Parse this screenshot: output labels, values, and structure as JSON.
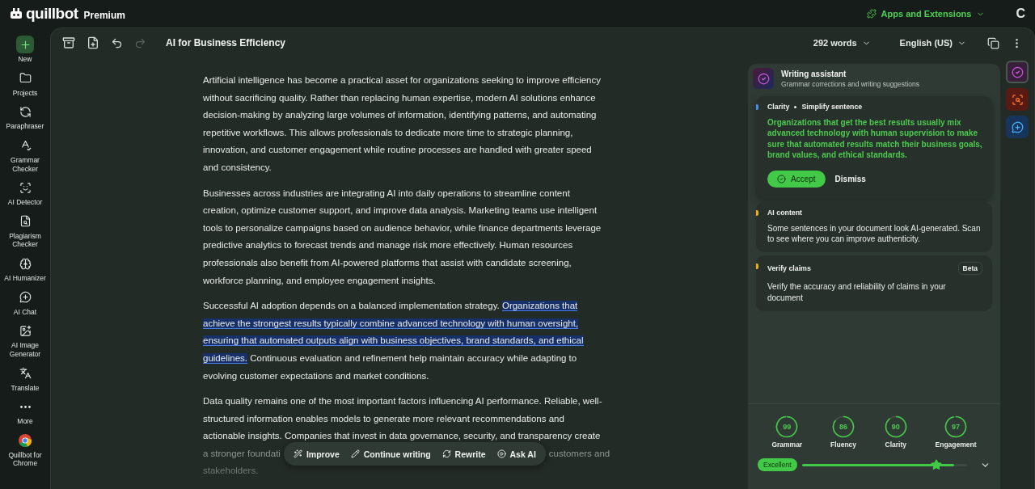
{
  "brand": {
    "name": "quillbot",
    "tier": "Premium"
  },
  "top_bar": {
    "apps": "Apps and Extensions",
    "avatar": "C"
  },
  "sidebar": {
    "items": [
      {
        "kind": "new",
        "label": "New",
        "selected": true
      },
      {
        "kind": "folder",
        "label": "Projects",
        "selected": false
      },
      {
        "kind": "paraphrase",
        "label": "Paraphraser",
        "selected": false
      },
      {
        "kind": "grammar",
        "label": "Grammar Checker",
        "selected": false
      },
      {
        "kind": "detector",
        "label": "AI Detector",
        "selected": false
      },
      {
        "kind": "plagiarism",
        "label": "Plagiarism Checker",
        "selected": false
      },
      {
        "kind": "humanizer",
        "label": "AI Humanizer",
        "selected": false
      },
      {
        "kind": "chat",
        "label": "AI Chat",
        "selected": false
      },
      {
        "kind": "image",
        "label": "AI Image Generator",
        "selected": false
      },
      {
        "kind": "translate",
        "label": "Translate",
        "selected": false
      },
      {
        "kind": "more",
        "label": "More",
        "selected": false
      },
      {
        "kind": "chrome",
        "label": "Quillbot for Chrome",
        "selected": false
      }
    ]
  },
  "editor": {
    "title": "AI for Business Efficiency",
    "redo_disabled": true,
    "word_count": "292 words",
    "language": "English (US)",
    "paragraphs": [
      {
        "segments": [
          {
            "text": "Artificial intelligence has become a practical asset for organizations seeking to improve efficiency without sacrificing quality. Rather than replacing human expertise, modern AI solutions enhance decision-making by analyzing large volumes of information, identifying patterns, and automating repetitive workflows. This allows professionals to dedicate more time to strategic planning, innovation, and customer engagement while routine processes are handled with greater speed and consistency.",
            "highlighted": false
          }
        ]
      },
      {
        "segments": [
          {
            "text": "Businesses across industries are integrating AI into daily operations to streamline content creation, optimize customer support, and improve data analysis. Marketing teams use intelligent tools to personalize campaigns based on audience behavior, while finance departments leverage predictive analytics to forecast trends and manage risk more effectively. Human resources professionals also benefit from AI-powered platforms that assist with candidate screening, workforce planning, and employee engagement insights.",
            "highlighted": false
          }
        ]
      },
      {
        "segments": [
          {
            "text": "Successful AI adoption depends on a balanced implementation strategy. ",
            "highlighted": false
          },
          {
            "text": "Organizations that achieve the strongest results typically combine advanced technology with human oversight, ensuring that automated outputs align with business objectives, brand standards, and ethical guidelines.",
            "highlighted": true
          },
          {
            "text": " Continuous evaluation and refinement help maintain accuracy while adapting to evolving customer expectations and market conditions.",
            "highlighted": false
          }
        ]
      },
      {
        "segments": [
          {
            "text": "Data quality remains one of the most important factors influencing AI performance. Reliable, well-structured information enables models to generate more relevant recommendations and actionable insights. Companies that invest in data governance, security, and transparency create",
            "highlighted": false
          }
        ]
      }
    ],
    "faded_line": {
      "left": "a stronger foundati",
      "right": "customers and"
    },
    "faded_last": "stakeholders.",
    "float_actions": [
      {
        "kind": "improve",
        "label": "Improve"
      },
      {
        "kind": "continue",
        "label": "Continue writing"
      },
      {
        "kind": "rewrite",
        "label": "Rewrite"
      },
      {
        "kind": "ask",
        "label": "Ask AI"
      }
    ]
  },
  "assistant": {
    "title": "Writing assistant",
    "subtitle": "Grammar corrections and writing suggestions",
    "cards": [
      {
        "kind": "suggestion",
        "color": "#4a8cf0",
        "label": "Clarity",
        "sublabel": "Simplify sentence",
        "text": "Organizations that get the best results usually mix advanced technology with human supervision to make sure that automated results match their business goals, brand values, and ethical standards.",
        "accept": "Accept",
        "dismiss": "Dismiss"
      },
      {
        "kind": "info",
        "color": "#f0b400",
        "label": "AI content",
        "text": "Some sentences in your document look AI-generated. Scan to see where you can improve authenticity."
      },
      {
        "kind": "info",
        "color": "#f0b400",
        "label": "Verify claims",
        "badge": "Beta",
        "text": "Verify the accuracy and reliability of claims in your document"
      }
    ],
    "scores": [
      {
        "value": "99",
        "label": "Grammar",
        "level": 0.99
      },
      {
        "value": "86",
        "label": "Fluency",
        "level": 0.86
      },
      {
        "value": "90",
        "label": "Clarity",
        "level": 0.9
      },
      {
        "value": "97",
        "label": "Engagement",
        "level": 0.97
      }
    ],
    "overall": {
      "label": "Excellent",
      "level": 0.92
    }
  },
  "rail": [
    {
      "kind": "assistant",
      "selected": true
    },
    {
      "kind": "detector",
      "selected": false
    },
    {
      "kind": "chat",
      "selected": false
    }
  ]
}
